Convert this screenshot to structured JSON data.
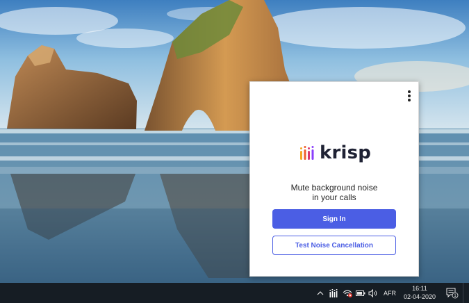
{
  "popup": {
    "menu_icon": "kebab-menu-icon",
    "logo_icon": "krisp-bars-icon",
    "logo_text": "krisp",
    "logo_colors": [
      "#f5a623",
      "#ef5d2f",
      "#d9376e",
      "#8a3ffc"
    ],
    "tagline_line1": "Mute background noise",
    "tagline_line2": "in your calls",
    "sign_in_label": "Sign In",
    "test_label": "Test Noise Cancellation",
    "accent_color": "#4b5ee4"
  },
  "taskbar": {
    "tray_icons": [
      "chevron-up-icon",
      "krisp-tray-icon",
      "network-warning-icon",
      "battery-icon",
      "volume-icon"
    ],
    "language": "AFR",
    "time": "16:11",
    "date": "02-04-2020",
    "notification_icon": "action-center-icon",
    "notification_count": "1"
  }
}
